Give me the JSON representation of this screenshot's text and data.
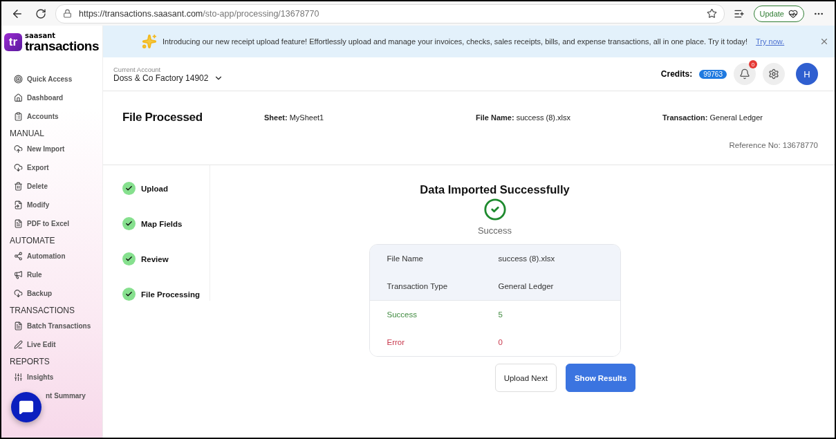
{
  "browser": {
    "url_host": "https://transactions.saasant.com",
    "url_path": "/sto-app/processing/13678770",
    "update_label": "Update"
  },
  "logo": {
    "mark": "tr",
    "brand": "saasant",
    "product": "transactions"
  },
  "banner": {
    "text": "Introducing our new receipt upload feature! Effortlessly upload and manage your invoices, checks, sales receipts, bills, and expense transactions, all in one place. Try it today!",
    "link": "Try now."
  },
  "sidebar": {
    "sections": [
      {
        "items": [
          {
            "label": "Quick Access"
          },
          {
            "label": "Dashboard"
          },
          {
            "label": "Accounts"
          }
        ]
      },
      {
        "heading": "MANUAL",
        "items": [
          {
            "label": "New Import"
          },
          {
            "label": "Export"
          },
          {
            "label": "Delete"
          },
          {
            "label": "Modify"
          },
          {
            "label": "PDF to Excel"
          }
        ]
      },
      {
        "heading": "AUTOMATE",
        "items": [
          {
            "label": "Automation"
          },
          {
            "label": "Rule"
          },
          {
            "label": "Backup"
          }
        ]
      },
      {
        "heading": "TRANSACTIONS",
        "items": [
          {
            "label": "Batch Transactions"
          },
          {
            "label": "Live Edit"
          }
        ]
      },
      {
        "heading": "REPORTS",
        "items": [
          {
            "label": "Insights"
          },
          {
            "label": "nt Summary"
          }
        ]
      }
    ]
  },
  "account": {
    "caption": "Current Account",
    "name": "Doss & Co Factory 14902"
  },
  "topbar": {
    "credits_label": "Credits:",
    "credits": "99763",
    "notifications": "0",
    "avatar": "H"
  },
  "file_info": {
    "title": "File Processed",
    "fields": [
      {
        "label": "Sheet:",
        "value": "MySheet1"
      },
      {
        "label": "File Name:",
        "value": "success (8).xlsx"
      },
      {
        "label": "Transaction:",
        "value": "General Ledger"
      }
    ],
    "reference": "Reference No: 13678770"
  },
  "steps": [
    {
      "label": "Upload",
      "done": true
    },
    {
      "label": "Map Fields",
      "done": true
    },
    {
      "label": "Review",
      "done": true
    },
    {
      "label": "File Processing",
      "done": true
    }
  ],
  "result": {
    "title": "Data Imported Successfully",
    "status": "Success",
    "rows": [
      {
        "kind": "info",
        "label": "File Name",
        "value": "success (8).xlsx"
      },
      {
        "kind": "info",
        "label": "Transaction Type",
        "value": "General Ledger"
      },
      {
        "kind": "success",
        "label": "Success",
        "value": "5"
      },
      {
        "kind": "error",
        "label": "Error",
        "value": "0"
      }
    ],
    "buttons": [
      {
        "label": "Upload Next",
        "primary": false
      },
      {
        "label": "Show Results",
        "primary": true
      }
    ]
  }
}
